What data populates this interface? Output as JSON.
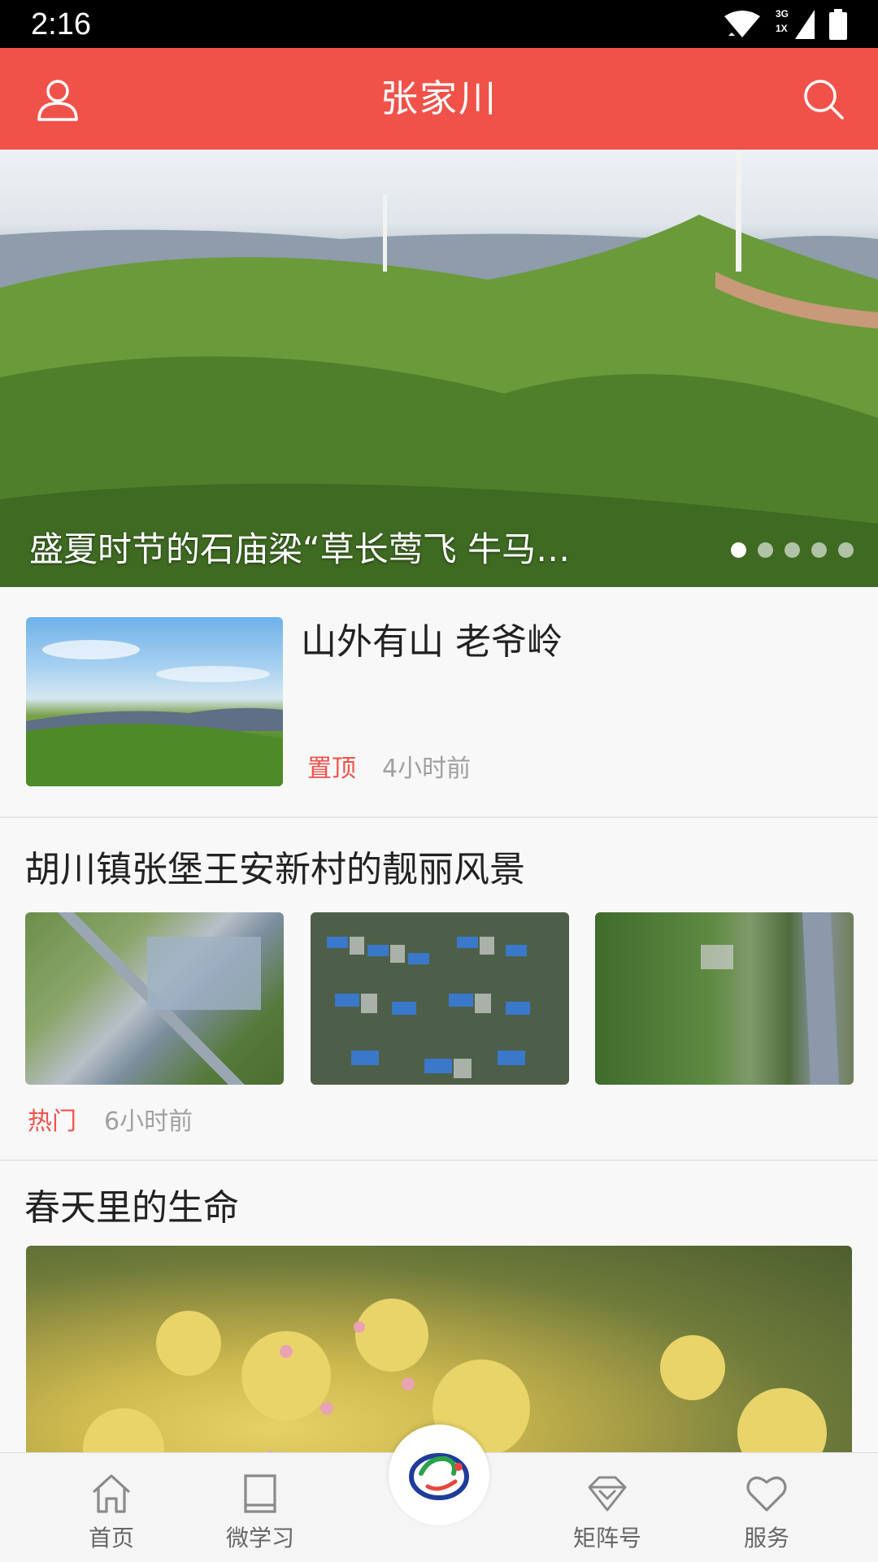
{
  "status_bar": {
    "time": "2:16",
    "network_label_top": "3G",
    "network_label_bottom": "1X"
  },
  "header": {
    "title": "张家川",
    "user_icon": "user-icon",
    "search_icon": "search-icon",
    "background": "#f0524a"
  },
  "banner": {
    "caption": "盛夏时节的石庙梁“草长莺飞 牛马…",
    "pages": 5,
    "active_page": 1
  },
  "articles": [
    {
      "title": "山外有山 老爷岭",
      "tag": "置顶",
      "time": "4小时前"
    },
    {
      "title": "胡川镇张堡王安新村的靓丽风景",
      "tag": "热门",
      "time": "6小时前"
    },
    {
      "title": "春天里的生命"
    }
  ],
  "tabbar": {
    "items": [
      {
        "label": "首页",
        "icon": "home-icon"
      },
      {
        "label": "微学习",
        "icon": "book-icon"
      },
      {
        "label": "矩阵号",
        "icon": "diamond-icon"
      },
      {
        "label": "服务",
        "icon": "heart-icon"
      }
    ],
    "center_icon": "app-logo-icon"
  },
  "colors": {
    "accent": "#f0524a",
    "muted": "#a0a0a0",
    "title": "#222222"
  }
}
